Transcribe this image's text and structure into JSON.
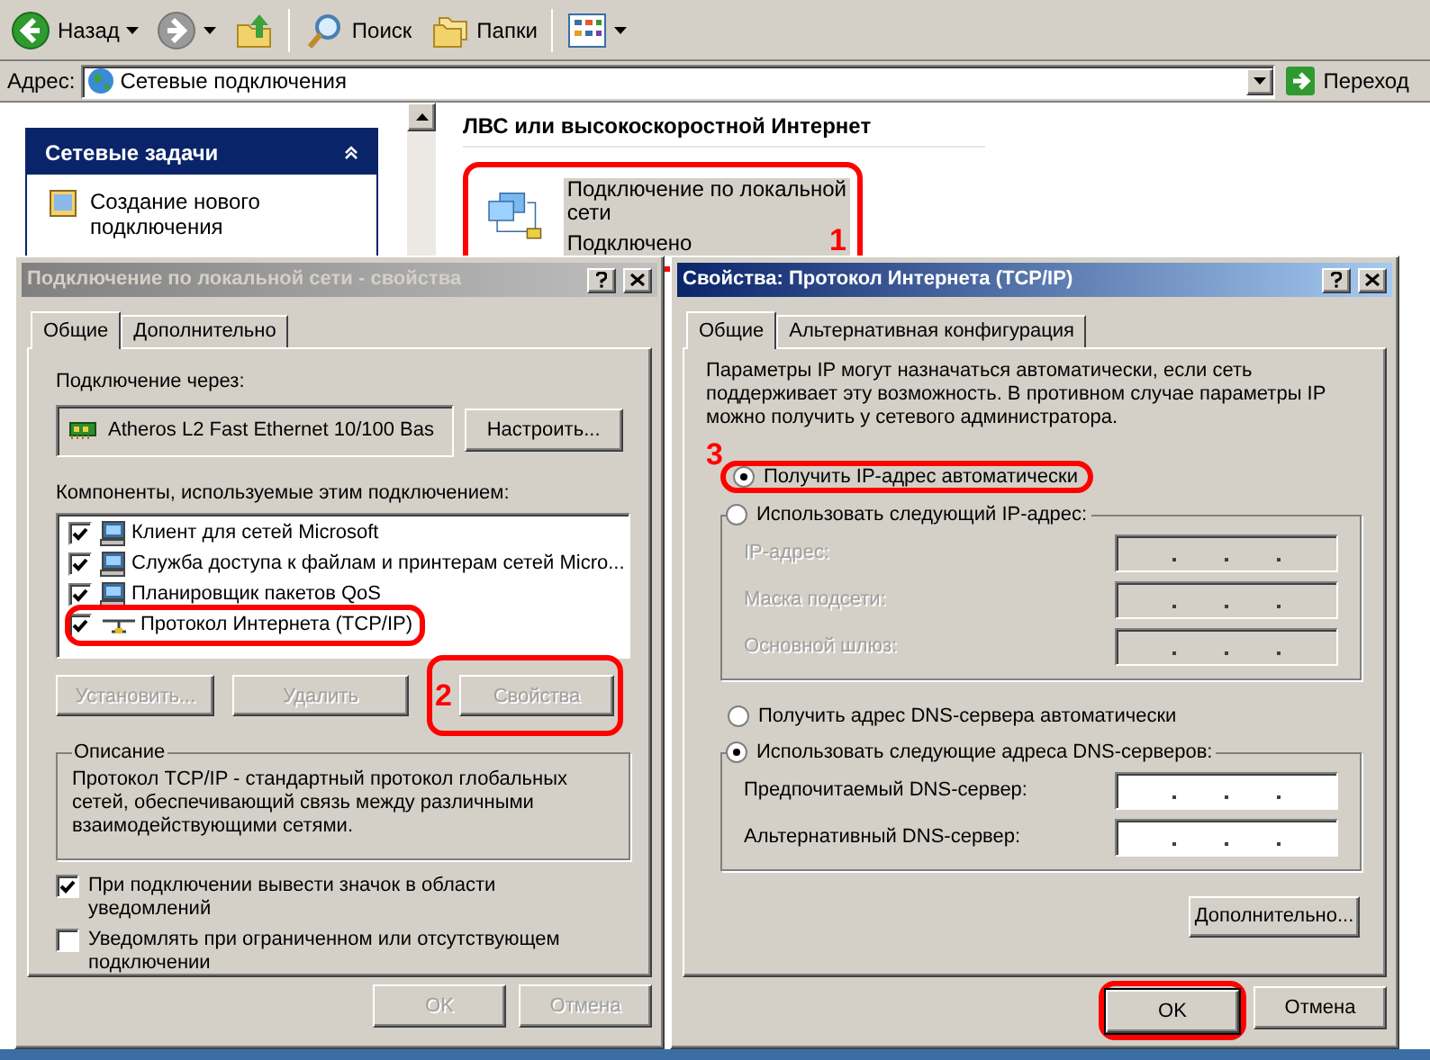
{
  "explorer": {
    "toolbar": [
      {
        "kind": "back",
        "label": "Назад",
        "disabled": false
      },
      {
        "kind": "forward",
        "disabled": true
      },
      {
        "kind": "up"
      },
      {
        "kind": "search",
        "label": "Поиск"
      },
      {
        "kind": "folders",
        "label": "Папки"
      },
      {
        "kind": "views"
      }
    ],
    "address": {
      "label": "Адрес:",
      "value": "Сетевые подключения",
      "go": "Переход"
    },
    "task_pane": {
      "title": "Сетевые задачи",
      "expanded": true,
      "items": [
        "Создание нового подключения"
      ]
    },
    "section_heading": "ЛВС или высокоскоростной Интернет",
    "connection": {
      "name_lines": [
        "Подключение по локальной",
        "сети"
      ],
      "status": "Подключено",
      "selected": true,
      "highlighted": true,
      "annotation": "1"
    }
  },
  "local_dialog": {
    "title": "Подключение по локальной сети - свойства",
    "active": false,
    "tabs": [
      {
        "label": "Общие",
        "selected": true
      },
      {
        "label": "Дополнительно",
        "selected": false
      }
    ],
    "connect_using_label": "Подключение через:",
    "adapter": "Atheros L2 Fast Ethernet 10/100 Bas",
    "configure_button": "Настроить...",
    "components_label": "Компоненты, используемые этим подключением:",
    "components": [
      {
        "label": "Клиент для сетей Microsoft",
        "checked": true,
        "kind": "client",
        "highlighted": false
      },
      {
        "label": "Служба доступа к файлам и принтерам сетей Micro...",
        "checked": true,
        "kind": "service",
        "highlighted": false
      },
      {
        "label": "Планировщик пакетов QoS",
        "checked": true,
        "kind": "service",
        "highlighted": false
      },
      {
        "label": "Протокол Интернета (TCP/IP)",
        "checked": true,
        "kind": "protocol",
        "highlighted": true
      }
    ],
    "buttons": [
      {
        "label": "Установить...",
        "disabled": true,
        "highlighted": false
      },
      {
        "label": "Удалить",
        "disabled": true,
        "highlighted": false
      },
      {
        "label": "Свойства",
        "disabled": true,
        "highlighted": true,
        "annotation": "2"
      }
    ],
    "description": {
      "title": "Описание",
      "text": "Протокол TCP/IP - стандартный протокол глобальных сетей, обеспечивающий связь между различными взаимодействующими сетями."
    },
    "options": [
      {
        "label": "При подключении вывести значок в области уведомлений",
        "checked": true
      },
      {
        "label": "Уведомлять при ограниченном или отсутствующем подключении",
        "checked": false
      }
    ],
    "footer": [
      {
        "label": "OK",
        "disabled": true
      },
      {
        "label": "Отмена",
        "disabled": true
      }
    ]
  },
  "tcpip_dialog": {
    "title": "Свойства: Протокол Интернета (TCP/IP)",
    "active": true,
    "tabs": [
      {
        "label": "Общие",
        "selected": true
      },
      {
        "label": "Альтернативная конфигурация",
        "selected": false
      }
    ],
    "intro": "Параметры IP могут назначаться автоматически, если сеть поддерживает эту возможность. В противном случае параметры IP можно получить у сетевого администратора.",
    "annotation": "3",
    "ip_modes": [
      {
        "label": "Получить IP-адрес автоматически",
        "selected": true,
        "highlighted": true
      },
      {
        "label": "Использовать следующий IP-адрес:",
        "selected": false,
        "highlighted": false
      }
    ],
    "ip_fields": [
      {
        "label": "IP-адрес:",
        "disabled": true
      },
      {
        "label": "Маска подсети:",
        "disabled": true
      },
      {
        "label": "Основной шлюз:",
        "disabled": true
      }
    ],
    "dns_modes": [
      {
        "label": "Получить адрес DNS-сервера автоматически",
        "selected": false
      },
      {
        "label": "Использовать следующие адреса DNS-серверов:",
        "selected": true
      }
    ],
    "dns_fields": [
      {
        "label": "Предпочитаемый DNS-сервер:",
        "disabled": false
      },
      {
        "label": "Альтернативный DNS-сервер:",
        "disabled": false
      }
    ],
    "advanced_button": "Дополнительно...",
    "footer": [
      {
        "label": "OK",
        "highlighted": true,
        "default": true
      },
      {
        "label": "Отмена",
        "highlighted": false,
        "default": false
      }
    ]
  }
}
